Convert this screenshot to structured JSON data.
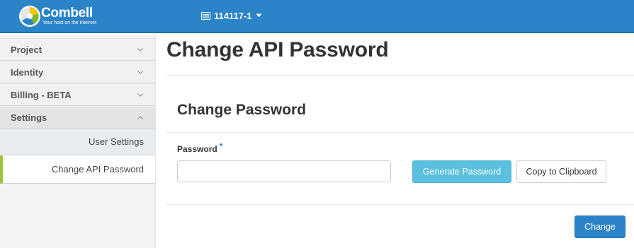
{
  "header": {
    "brand_name": "Combell",
    "brand_tagline": "Your host on the internet",
    "account_label": "114117-1",
    "colors": {
      "bar": "#2a84c7",
      "accent_green": "#9fc43a"
    }
  },
  "sidebar": {
    "sections": [
      {
        "label": "Project",
        "state": "collapsed"
      },
      {
        "label": "Identity",
        "state": "collapsed"
      },
      {
        "label": "Billing - BETA",
        "state": "collapsed"
      },
      {
        "label": "Settings",
        "state": "expanded"
      }
    ],
    "settings_items": [
      {
        "label": "User Settings",
        "active": false
      },
      {
        "label": "Change API Password",
        "active": true
      }
    ]
  },
  "main": {
    "page_title": "Change API Password",
    "section_title": "Change Password",
    "password_label": "Password",
    "required_mark": "*",
    "password_value": "",
    "generate_button": "Generate Password",
    "copy_button": "Copy to Clipboard",
    "submit_button": "Change"
  }
}
